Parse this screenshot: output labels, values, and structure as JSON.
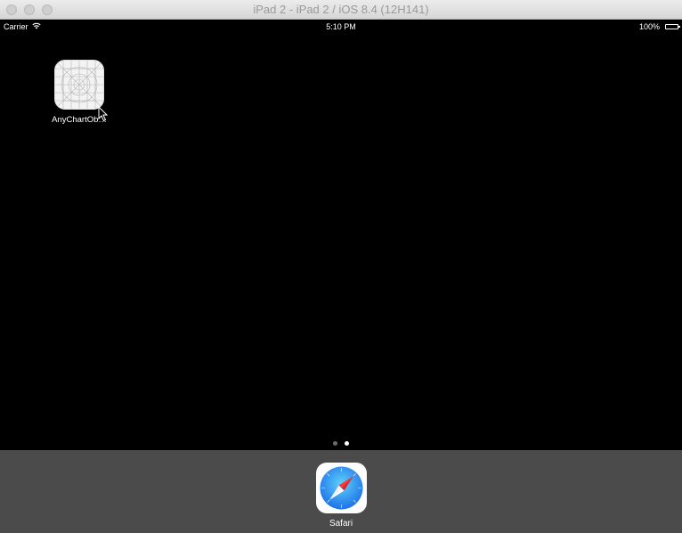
{
  "window": {
    "title": "iPad 2 - iPad 2 / iOS 8.4 (12H141)"
  },
  "status_bar": {
    "carrier": "Carrier",
    "time": "5:10 PM",
    "battery": "100%",
    "battery_level": 1.0
  },
  "home_screen": {
    "apps": [
      {
        "label": "AnyChartOb…",
        "icon": "placeholder-app-icon"
      }
    ],
    "page_count": 2,
    "active_page": 2
  },
  "dock": {
    "apps": [
      {
        "label": "Safari",
        "icon": "safari-compass-icon"
      }
    ]
  },
  "colors": {
    "screen_bg": "#000000",
    "dock_bg": "#4b4b4b",
    "safari_blue": "#1e8ff4"
  }
}
